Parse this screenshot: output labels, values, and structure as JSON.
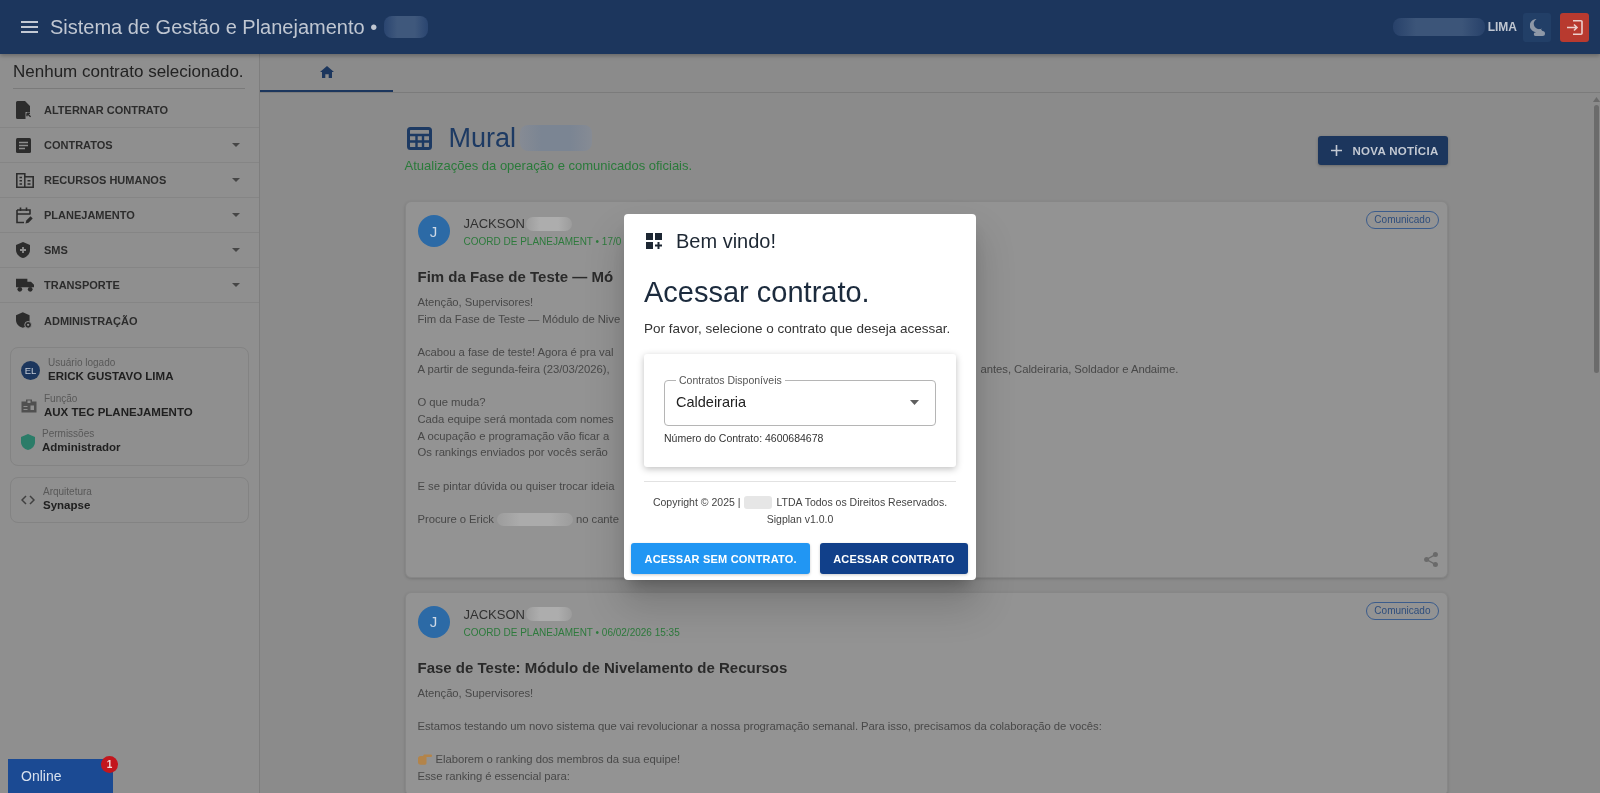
{
  "top_bar": {
    "title": "Sistema de Gestão e Planejamento •",
    "title_redacted": true,
    "user_name": "LIMA",
    "user_name_redacted": true
  },
  "sidebar": {
    "contract_status": "Nenhum contrato selecionado.",
    "menu": [
      {
        "label": "ALTERNAR CONTRATO",
        "expandable": false
      },
      {
        "label": "CONTRATOS",
        "expandable": true
      },
      {
        "label": "RECURSOS HUMANOS",
        "expandable": true
      },
      {
        "label": "PLANEJAMENTO",
        "expandable": true
      },
      {
        "label": "SMS",
        "expandable": true
      },
      {
        "label": "TRANSPORTE",
        "expandable": true
      },
      {
        "label": "ADMINISTRAÇÃO",
        "expandable": false
      }
    ],
    "user_card": {
      "avatar": "EL",
      "user_label": "Usuário logado",
      "user_name": "ERICK GUSTAVO LIMA",
      "fields": [
        {
          "label": "Função",
          "value": "AUX TEC PLANEJAMENTO"
        },
        {
          "label": "Permissões",
          "value": "Administrador"
        }
      ]
    },
    "architecture": {
      "label": "Arquitetura",
      "value": "Synapse"
    }
  },
  "online_widget": {
    "label": "Online",
    "badge": "1"
  },
  "tabs": [
    {
      "kind": "home",
      "selected": true
    }
  ],
  "mural": {
    "title": "Mural",
    "title_redacted": true,
    "subtitle": "Atualizações da operação e comunicados oficiais.",
    "new_button": "NOVA NOTÍCIA"
  },
  "posts": [
    {
      "avatar": "J",
      "author": "JACKSON",
      "author_redacted": true,
      "meta": "COORD DE PLANEJAMENT • 17/0",
      "tag": "Comunicado",
      "title": "Fim da Fase de Teste — Mó",
      "paragraphs": [
        [
          {
            "kind": "text",
            "text": "Atenção, Supervisores!"
          },
          {
            "kind": "text",
            "text": "Fim da Fase de Teste — Módulo de Nive"
          }
        ],
        [
          {
            "kind": "text",
            "text": "Acabou a fase de teste! Agora é pra val"
          },
          {
            "kind": "covered",
            "text": "A partir de segunda-feira (23/03/2026),",
            "tail": "antes, Caldeiraria, Soldador e Andaime."
          }
        ],
        [
          {
            "kind": "text",
            "text": "O que muda?"
          },
          {
            "kind": "text",
            "text": "Cada equipe será montada com nomes"
          },
          {
            "kind": "text",
            "text": "A ocupação e programação vão ficar a"
          },
          {
            "kind": "text",
            "text": "Os rankings enviados por vocês serão"
          }
        ],
        [
          {
            "kind": "text",
            "text": "E se pintar dúvida ou quiser trocar ideia"
          }
        ],
        [
          {
            "kind": "redacted",
            "text": "Procure o Erick",
            "after": "no cante"
          }
        ]
      ],
      "share_button": true
    },
    {
      "avatar": "J",
      "author": "JACKSON",
      "author_redacted": true,
      "meta": "COORD DE PLANEJAMENT • 06/02/2026 15:35",
      "tag": "Comunicado",
      "title": "Fase de Teste: Módulo de Nivelamento de Recursos",
      "paragraphs": [
        [
          {
            "kind": "text",
            "text": "Atenção, Supervisores!"
          }
        ],
        [
          {
            "kind": "text",
            "text": "Estamos testando um novo sistema que vai revolucionar a nossa programação semanal. Para isso, precisamos da colaboração de vocês:"
          }
        ],
        [
          {
            "kind": "pointer",
            "text": "Elaborem o ranking dos membros da sua equipe!"
          },
          {
            "kind": "text",
            "text": "Esse ranking é essencial para:"
          }
        ]
      ]
    }
  ],
  "dialog": {
    "title": "Bem vindo!",
    "heading": "Acessar contrato.",
    "prompt": "Por favor, selecione o contrato que deseja acessar.",
    "select": {
      "label": "Contratos Disponíveis",
      "value": "Caldeiraria"
    },
    "contract_number": "Número do Contrato: 4600684678",
    "copyright": {
      "before": "Copyright © 2025 |",
      "after": "LTDA Todos os Direitos Reservados.",
      "redacted": true
    },
    "version": "Sigplan v1.0.0",
    "buttons": [
      {
        "label": "ACESSAR SEM CONTRATO.",
        "kind": "secondary"
      },
      {
        "label": "ACESSAR CONTRATO",
        "kind": "primary"
      }
    ]
  }
}
